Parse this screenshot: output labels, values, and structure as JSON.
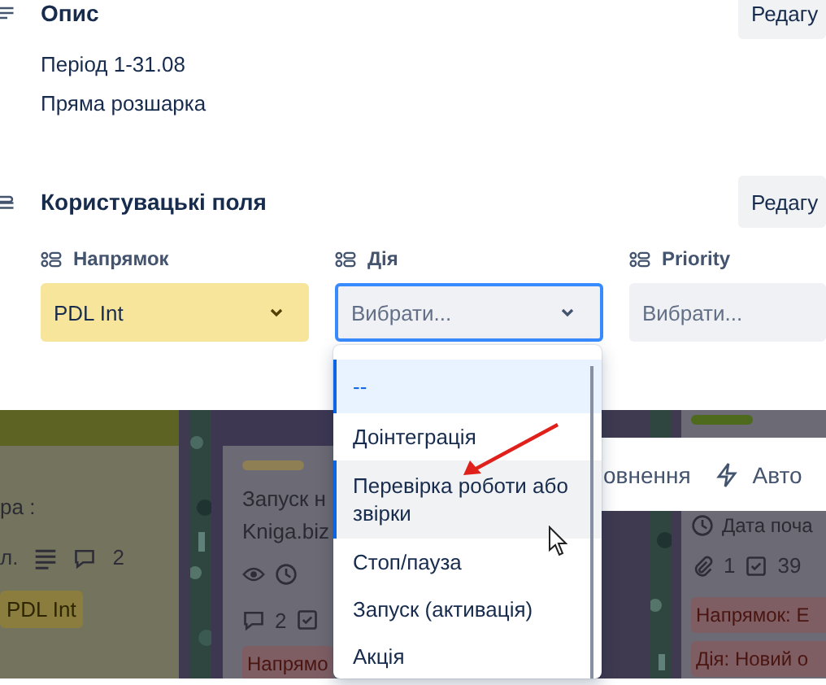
{
  "description": {
    "title": "Опис",
    "edit_button": "Редагу",
    "lines": [
      "Період 1-31.08",
      "Пряма розшарка"
    ]
  },
  "custom_fields": {
    "title": "Користувацькі поля",
    "edit_button": "Редагу",
    "fields": [
      {
        "label": "Напрямок",
        "value": "PDL Int",
        "color": "#f7e59c",
        "focused": false,
        "chevron": true
      },
      {
        "label": "Дія",
        "placeholder": "Вибрати...",
        "color": "#f0f1f4",
        "focused": true,
        "chevron": true
      },
      {
        "label": "Priority",
        "placeholder": "Вибрати...",
        "color": "#f0f1f4",
        "focused": false
      }
    ]
  },
  "dropdown": {
    "options": [
      {
        "label": "--",
        "selected": true,
        "hovered": false
      },
      {
        "label": "Доінтеграція",
        "selected": false,
        "hovered": false
      },
      {
        "label": "Перевірка роботи або звірки",
        "selected": false,
        "hovered": true
      },
      {
        "label": "Стоп/пауза",
        "selected": false,
        "hovered": false
      },
      {
        "label": "Запуск (активація)",
        "selected": false,
        "hovered": false
      },
      {
        "label": "Акція",
        "selected": false,
        "hovered": false
      }
    ]
  },
  "toolbar": {
    "items": [
      {
        "kind": "text",
        "label": "овнення"
      },
      {
        "kind": "automation",
        "label": "Авто"
      }
    ]
  },
  "board": {
    "cards": [
      {
        "title": "ра :",
        "meta": [
          {
            "kind": "text",
            "label": "л."
          },
          {
            "kind": "description"
          },
          {
            "kind": "comments",
            "label": "2"
          }
        ],
        "badges": [
          {
            "label": "PDL Int",
            "color": "#8a7d3e"
          }
        ]
      },
      {
        "title": "Запуск н\nKniga.biz",
        "meta": [
          {
            "kind": "watch"
          },
          {
            "kind": "clock"
          },
          {
            "kind": "break"
          },
          {
            "kind": "comments",
            "label": "2"
          },
          {
            "kind": "checklist"
          }
        ],
        "badges": [
          {
            "label": "Напрямо",
            "color": "#7e5e63"
          }
        ]
      },
      {
        "title": "Дата поча",
        "meta": [
          {
            "kind": "attachments",
            "label": "1"
          },
          {
            "kind": "checklist",
            "label": "39"
          }
        ],
        "badges": [
          {
            "label": "Напрямок: Е",
            "color": "#7e5e63"
          },
          {
            "label": "Дія: Новий о",
            "color": "#7e5e63"
          }
        ]
      }
    ]
  }
}
